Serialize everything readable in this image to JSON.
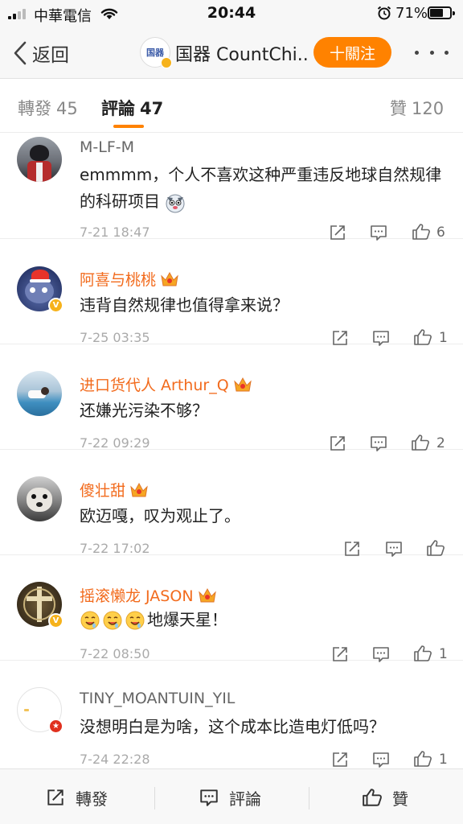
{
  "status_bar": {
    "carrier": "中華電信",
    "time": "20:44",
    "battery": "71%",
    "battery_level": 0.71
  },
  "nav": {
    "back_label": "返回",
    "avatar_logo_text": "国器",
    "title": "国器 CountChi...",
    "follow_label": "十關注"
  },
  "tabs": [
    {
      "label": "轉發",
      "count": "45"
    },
    {
      "label": "評論",
      "count": "47"
    },
    {
      "label": "贊",
      "count": "120"
    }
  ],
  "comments": [
    {
      "name": "M-LF-M",
      "text": "emmmm，个人不喜欢这种严重违反地球自然规律的科研项目",
      "emoji": "husky-emoji-icon",
      "time": "7-21 18:47",
      "likes": "6",
      "vip": false,
      "verified": false
    },
    {
      "name": "阿喜与桃桃",
      "text": "违背自然规律也值得拿来说？",
      "time": "7-25 03:35",
      "likes": "1",
      "vip": true,
      "verified": true
    },
    {
      "name": "进口货代人 Arthur_Q",
      "text": "还嫌光污染不够？",
      "time": "7-22 09:29",
      "likes": "2",
      "vip": true,
      "verified": false
    },
    {
      "name": "傻壮甜",
      "text": "欧迈嘎，叹为观止了。",
      "time": "7-22 17:02",
      "likes": "",
      "vip": true,
      "verified": false
    },
    {
      "name": "摇滚懒龙 JASON",
      "text": "地爆天星！",
      "time": "7-22 08:50",
      "likes": "1",
      "vip": true,
      "verified": true
    },
    {
      "name": "TINY_MOANTUIN_YIL",
      "text": "没想明白是为啥，这个成本比造电灯低吗？",
      "time": "7-24 22:28",
      "likes": "1",
      "vip": false,
      "verified": true
    }
  ],
  "bottom_bar": {
    "repost": "轉發",
    "comment": "評論",
    "like": "贊"
  },
  "colors": {
    "accent": "#ff8200",
    "vip_name": "#f26b1d",
    "verified_badge": "#f6b21b",
    "red_badge": "#e0301e"
  }
}
